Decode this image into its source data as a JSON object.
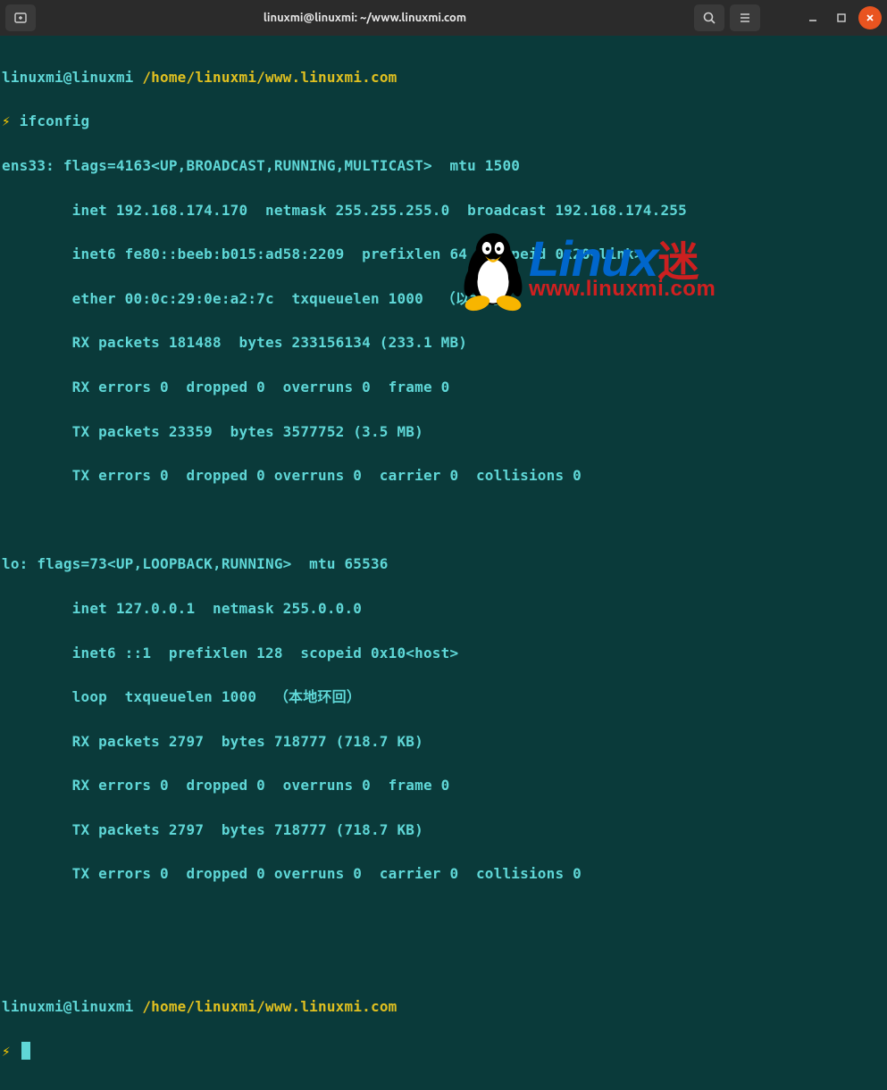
{
  "window": {
    "title": "linuxmi@linuxmi: ~/www.linuxmi.com"
  },
  "prompt": {
    "userhost": "linuxmi@linuxmi",
    "path": "/home/linuxmi/www.linuxmi.com",
    "bolt": "⚡",
    "command": "ifconfig"
  },
  "output": {
    "ens33": {
      "l1": "ens33: flags=4163<UP,BROADCAST,RUNNING,MULTICAST>  mtu 1500",
      "l2": "        inet 192.168.174.170  netmask 255.255.255.0  broadcast 192.168.174.255",
      "l3": "        inet6 fe80::beeb:b015:ad58:2209  prefixlen 64  scopeid 0x20<link>",
      "l4": "        ether 00:0c:29:0e:a2:7c  txqueuelen 1000  （以太网）",
      "l5": "        RX packets 181488  bytes 233156134 (233.1 MB)",
      "l6": "        RX errors 0  dropped 0  overruns 0  frame 0",
      "l7": "        TX packets 23359  bytes 3577752 (3.5 MB)",
      "l8": "        TX errors 0  dropped 0 overruns 0  carrier 0  collisions 0"
    },
    "lo": {
      "l1": "lo: flags=73<UP,LOOPBACK,RUNNING>  mtu 65536",
      "l2": "        inet 127.0.0.1  netmask 255.0.0.0",
      "l3": "        inet6 ::1  prefixlen 128  scopeid 0x10<host>",
      "l4": "        loop  txqueuelen 1000  （本地环回）",
      "l5": "        RX packets 2797  bytes 718777 (718.7 KB)",
      "l6": "        RX errors 0  dropped 0  overruns 0  frame 0",
      "l7": "        TX packets 2797  bytes 718777 (718.7 KB)",
      "l8": "        TX errors 0  dropped 0 overruns 0  carrier 0  collisions 0"
    }
  },
  "watermark": {
    "brand_text": "Linux",
    "brand_cn": "迷",
    "url": "www.linuxmi.com"
  }
}
